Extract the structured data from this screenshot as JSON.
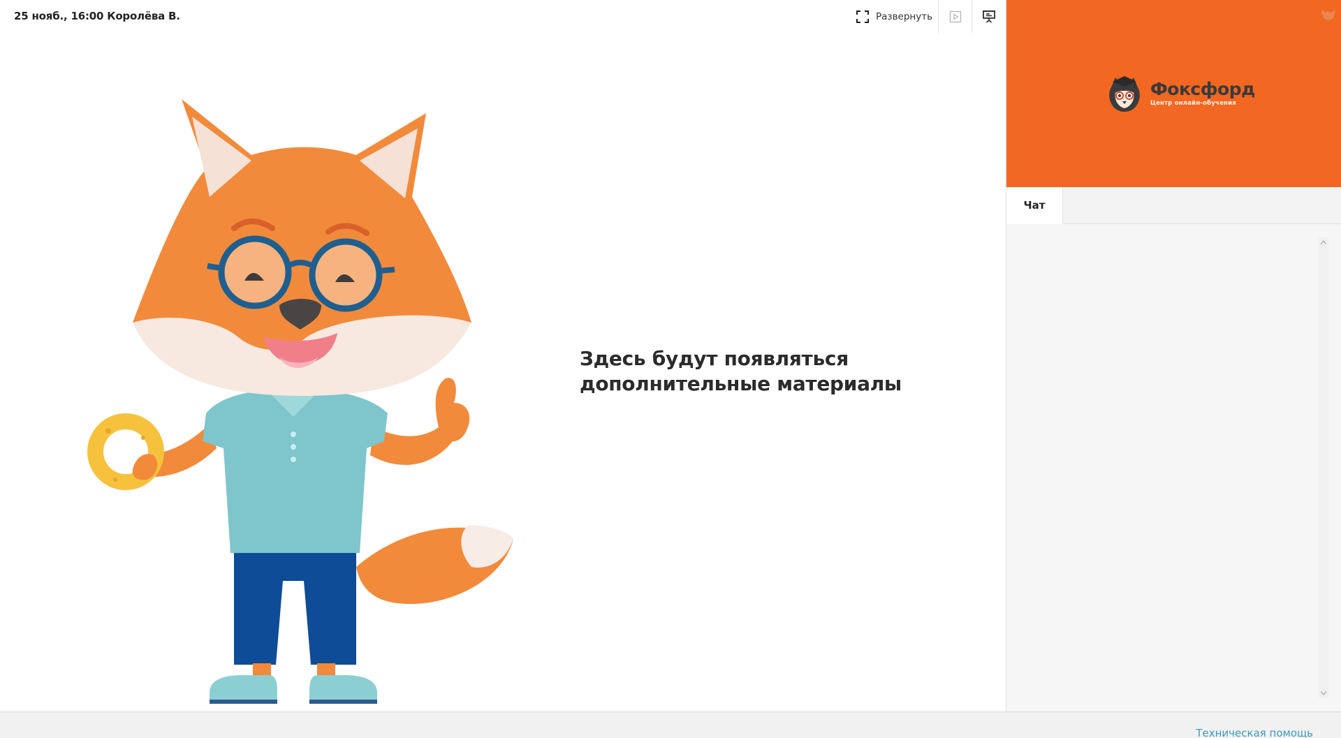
{
  "header": {
    "lesson_title": "25 нояб., 16:00 Королёва В.",
    "expand_label": "Развернуть",
    "icons": {
      "expand": "fullscreen-icon",
      "play": "play-icon",
      "presentation": "presentation-icon"
    }
  },
  "main": {
    "placeholder_text": "Здесь будут появляться дополнительные материалы",
    "illustration": "fox-mascot-illustration"
  },
  "video": {
    "brand_name": "Фоксфорд",
    "brand_subtitle": "Центр онлайн-обучения",
    "background_color": "#f26722"
  },
  "sidebar": {
    "tabs": [
      {
        "label": "Чат",
        "active": true
      }
    ]
  },
  "footer": {
    "help_label": "Техническая помощь"
  },
  "colors": {
    "accent": "#f26722",
    "link": "#3b9bbf"
  }
}
